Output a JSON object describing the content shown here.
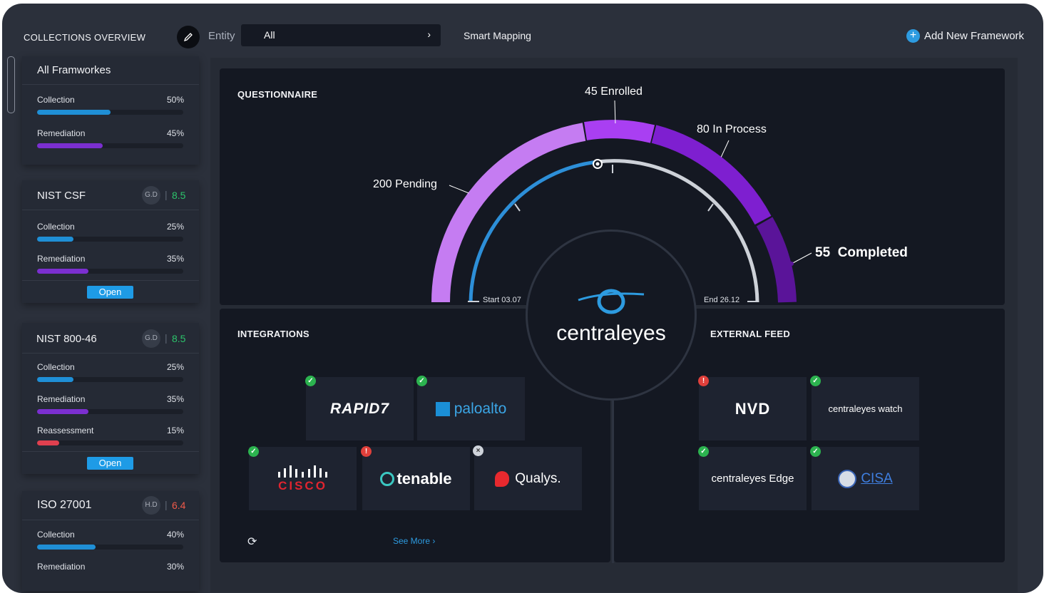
{
  "header": {
    "title": "COLLECTIONS OVERVIEW",
    "entity_label": "Entity",
    "entity_value": "All",
    "smart_mapping": "Smart Mapping",
    "add_framework": "Add New Framework"
  },
  "sidebar": {
    "all": {
      "title": "All Framworkes",
      "rows": [
        {
          "label": "Collection",
          "pct": "50%",
          "value": 50,
          "color": "#1f8fd6"
        },
        {
          "label": "Remediation",
          "pct": "45%",
          "value": 45,
          "color": "#7b2fd0"
        }
      ]
    },
    "nist_csf": {
      "title": "NIST CSF",
      "badge": "G.D",
      "score": "8.5",
      "score_color": "#2cc46b",
      "rows": [
        {
          "label": "Collection",
          "pct": "25%",
          "value": 25,
          "color": "#1f8fd6"
        },
        {
          "label": "Remediation",
          "pct": "35%",
          "value": 35,
          "color": "#7b2fd0"
        }
      ],
      "open": "Open"
    },
    "nist_800": {
      "title": "NIST 800-46",
      "badge": "G.D",
      "score": "8.5",
      "score_color": "#2cc46b",
      "rows": [
        {
          "label": "Collection",
          "pct": "25%",
          "value": 25,
          "color": "#1f8fd6"
        },
        {
          "label": "Remediation",
          "pct": "35%",
          "value": 35,
          "color": "#7b2fd0"
        },
        {
          "label": "Reassessment",
          "pct": "15%",
          "value": 15,
          "color": "#e0404f"
        }
      ],
      "open": "Open"
    },
    "iso": {
      "title": "ISO 27001",
      "badge": "H.D",
      "score": "6.4",
      "score_color": "#f05a4a",
      "rows": [
        {
          "label": "Collection",
          "pct": "40%",
          "value": 40,
          "color": "#1f8fd6"
        },
        {
          "label": "Remediation",
          "pct": "30%",
          "value": 30,
          "color": "#7b2fd0"
        }
      ]
    }
  },
  "questionnaire": {
    "title": "QUESTIONNAIRE",
    "pending": "200 Pending",
    "enrolled": "45 Enrolled",
    "in_process": "80 In Process",
    "completed": "55  Completed",
    "start": "Start 03.07",
    "end": "End 26.12"
  },
  "brand": "centraleyes",
  "integrations": {
    "title": "INTEGRATIONS",
    "tiles": [
      {
        "name": "RAPID7",
        "status": "ok"
      },
      {
        "name": "paloalto",
        "status": "ok"
      },
      {
        "name": "CISCO",
        "status": "ok"
      },
      {
        "name": "tenable",
        "status": "warn"
      },
      {
        "name": "Qualys.",
        "status": "x"
      }
    ],
    "see_more": "See More ›"
  },
  "external_feed": {
    "title": "EXTERNAL FEED",
    "tiles": [
      {
        "name": "NVD",
        "status": "warn"
      },
      {
        "name": "centraleyes watch",
        "status": "ok"
      },
      {
        "name": "centraleyes Edge",
        "status": "ok"
      },
      {
        "name": "CISA",
        "status": "ok"
      }
    ]
  },
  "icons": [
    "pencil-icon",
    "chevron-right-icon",
    "plus-icon",
    "refresh-icon",
    "check-icon",
    "alert-icon",
    "close-icon"
  ]
}
